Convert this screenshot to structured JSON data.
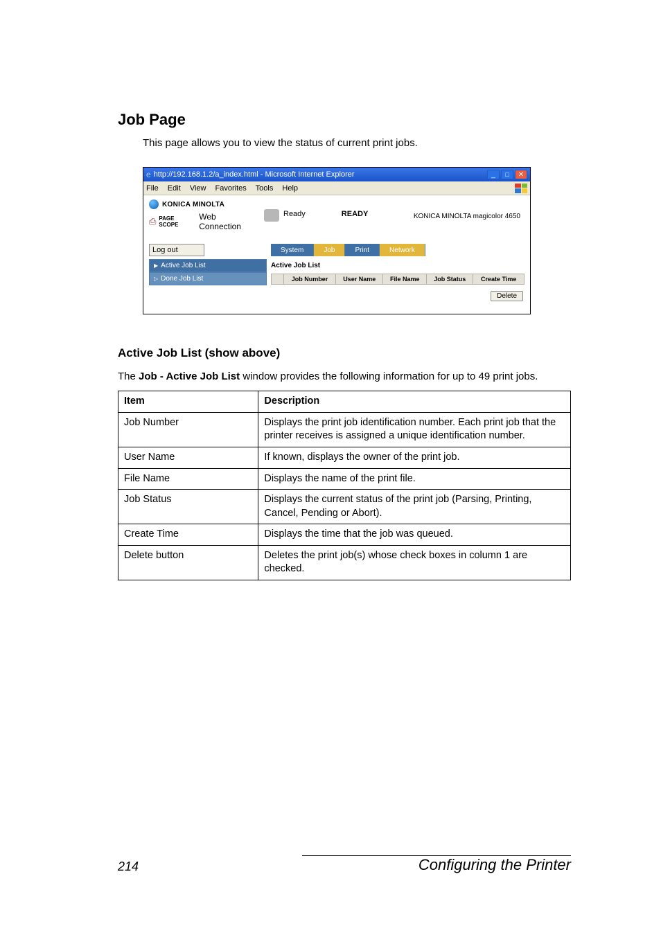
{
  "heading": "Job Page",
  "intro": "This page allows you to view the status of current print jobs.",
  "screenshot": {
    "titlebar": "http://192.168.1.2/a_index.html - Microsoft Internet Explorer",
    "menu": {
      "file": "File",
      "edit": "Edit",
      "view": "View",
      "favorites": "Favorites",
      "tools": "Tools",
      "help": "Help"
    },
    "brand": "KONICA MINOLTA",
    "pagescope_prefix": "PAGE SCOPE",
    "connection": "Web Connection",
    "ready_small": "Ready",
    "ready_bold": "READY",
    "model": "KONICA MINOLTA magicolor 4650",
    "logout": "Log out",
    "tabs": {
      "system": "System",
      "job": "Job",
      "print": "Print",
      "network": "Network"
    },
    "side": {
      "active": "Active Job List",
      "done": "Done Job List"
    },
    "panel_title": "Active Job List",
    "cols": {
      "num": "Job Number",
      "user": "User Name",
      "file": "File Name",
      "status": "Job Status",
      "create": "Create Time"
    },
    "delete": "Delete"
  },
  "subhead": "Active Job List (show above)",
  "para_prefix": "The ",
  "para_bold": "Job - Active Job List",
  "para_suffix": " window provides the following information for up to 49 print jobs.",
  "table": {
    "header": {
      "item": "Item",
      "desc": "Description"
    },
    "rows": [
      {
        "item": "Job Number",
        "desc": "Displays the print job identification number. Each print job that the printer receives is assigned a unique identification number."
      },
      {
        "item": "User Name",
        "desc": "If known, displays the owner of the print job."
      },
      {
        "item": "File Name",
        "desc": "Displays the name of the print file."
      },
      {
        "item": "Job Status",
        "desc": "Displays the current status of the print job (Parsing, Printing, Cancel, Pending or Abort)."
      },
      {
        "item": "Create Time",
        "desc": "Displays the time that the job was queued."
      },
      {
        "item": "Delete button",
        "desc": "Deletes the print job(s) whose check boxes in column 1 are checked."
      }
    ]
  },
  "footer": {
    "page": "214",
    "title": "Configuring the Printer"
  }
}
